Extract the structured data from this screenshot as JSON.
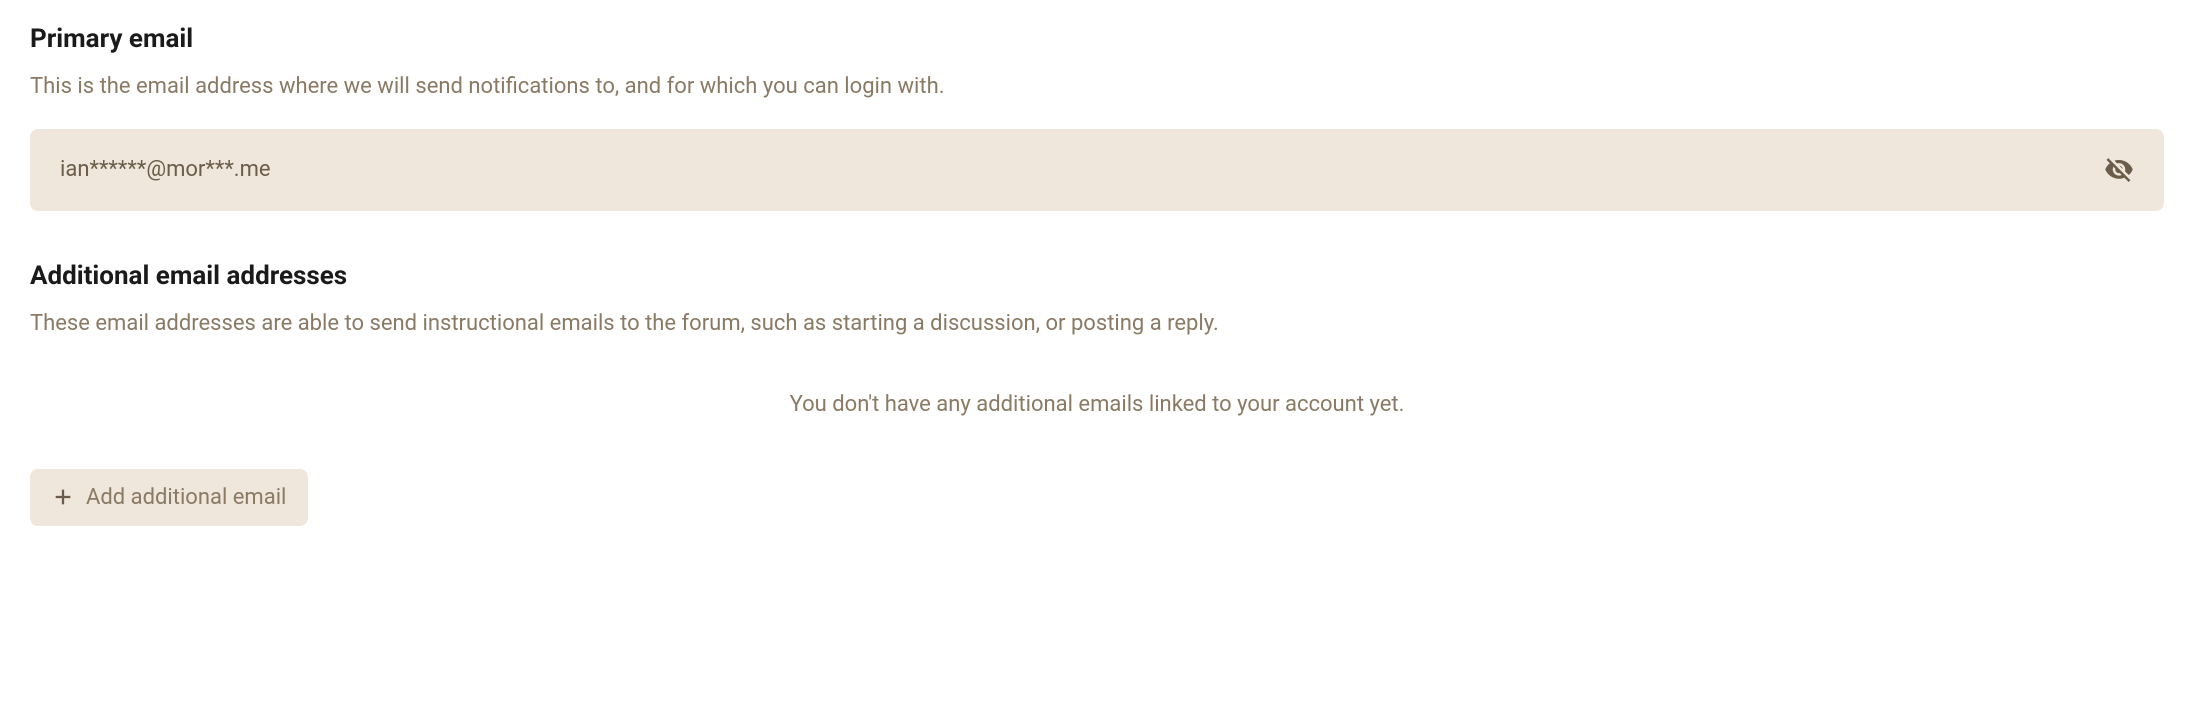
{
  "primary": {
    "heading": "Primary email",
    "description": "This is the email address where we will send notifications to, and for which you can login with.",
    "value": "ian******@mor***.me"
  },
  "additional": {
    "heading": "Additional email addresses",
    "description": "These email addresses are able to send instructional emails to the forum, such as starting a discussion, or posting a reply.",
    "empty_message": "You don't have any additional emails linked to your account yet.",
    "add_button_label": "Add additional email"
  }
}
